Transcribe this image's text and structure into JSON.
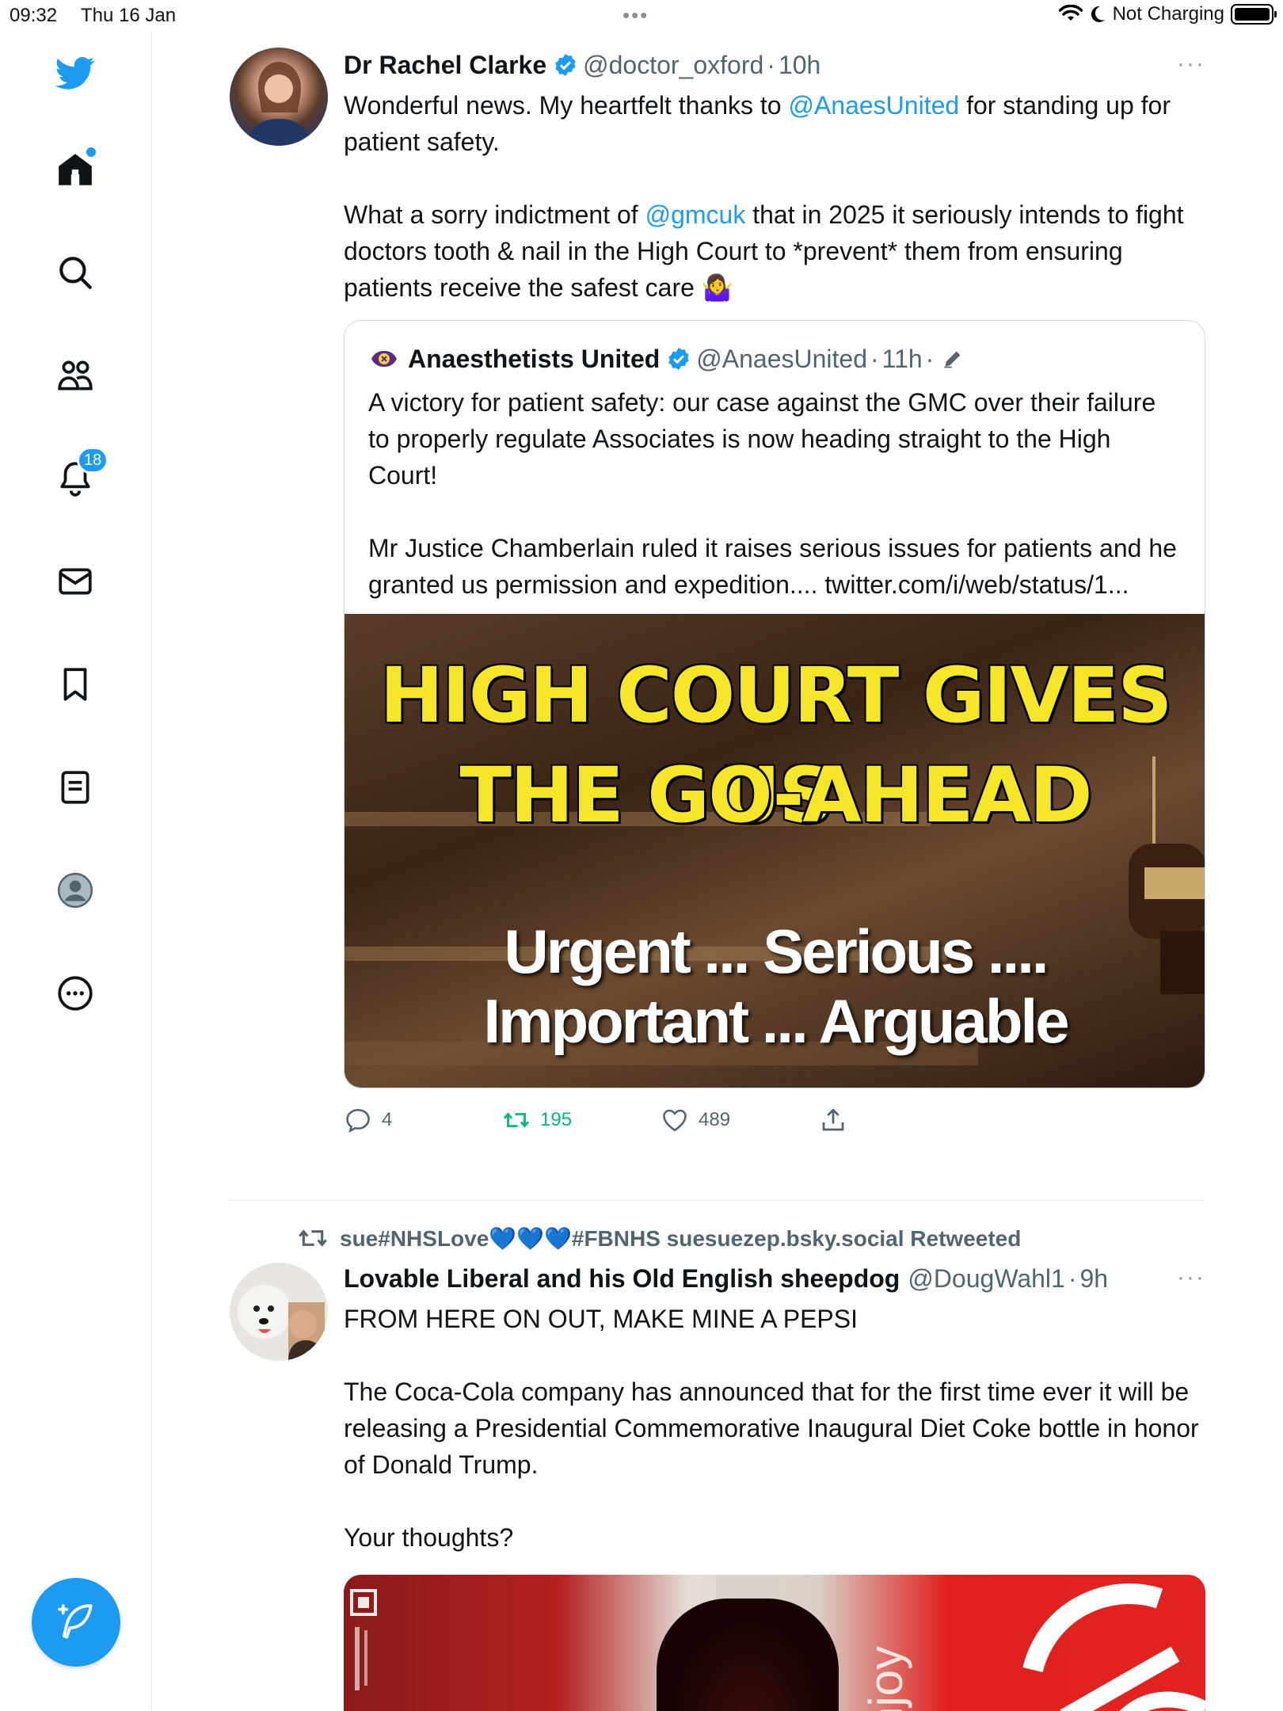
{
  "status_bar": {
    "time": "09:32",
    "date": "Thu 16 Jan",
    "battery_text": "Not Charging"
  },
  "sidebar": {
    "items": [
      {
        "icon": "twitter-logo-icon"
      },
      {
        "icon": "home-icon"
      },
      {
        "icon": "search-icon"
      },
      {
        "icon": "communities-icon"
      },
      {
        "icon": "notifications-icon",
        "badge": "18"
      },
      {
        "icon": "messages-icon"
      },
      {
        "icon": "bookmarks-icon"
      },
      {
        "icon": "lists-icon"
      },
      {
        "icon": "profile-icon"
      },
      {
        "icon": "more-icon"
      }
    ],
    "compose_icon": "compose-tweet-icon"
  },
  "colors": {
    "accent": "#1d9bf0",
    "retweet_green": "#00ba7c",
    "secondary_text": "#536471",
    "border": "#cfd9de",
    "image_title_yellow": "#f5e62a"
  },
  "tweet1": {
    "name": "Dr Rachel Clarke",
    "handle": "@doctor_oxford",
    "sep": "·",
    "time": "10h",
    "more": "···",
    "p1_a": "Wonderful news. My heartfelt thanks to ",
    "p1_mention": "@AnaesUnited",
    "p1_b": " for standing up for patient safety.",
    "p2_a": "What a sorry indictment of ",
    "p2_mention": "@gmcuk",
    "p2_b": " that in 2025 it seriously intends to fight doctors tooth & nail in the High Court to *prevent* them from ensuring patients receive the safest care 🤷‍♀️",
    "quote": {
      "name": "Anaesthetists United",
      "handle": "@AnaesUnited",
      "sep": "·",
      "time": "11h",
      "sep2": "·",
      "p1": "A victory for patient safety: our case against the GMC over their failure to properly regulate Associates is now heading straight to the High Court!",
      "p2": "Mr Justice Chamberlain ruled it raises serious issues for patients and he granted us permission and expedition.... twitter.com/i/web/status/1...",
      "image_line1": "HIGH COURT GIVES US",
      "image_line2": "THE GO-AHEAD",
      "image_line3": "Urgent ... Serious ....",
      "image_line4": "Important ... Arguable"
    },
    "replies": "4",
    "retweets": "195",
    "likes": "489"
  },
  "tweet2": {
    "retweeted_by": "sue#NHSLove💙💙💙#FBNHS suesuezep.bsky.social Retweeted",
    "name": "Lovable Liberal and his Old English sheepdog",
    "handle": "@DougWahl1",
    "sep": "·",
    "time": "9h",
    "more": "···",
    "p1": "FROM HERE ON OUT, MAKE MINE A PEPSI",
    "p2": "The Coca-Cola company has announced that for the first time ever it will be releasing a Presidential Commemorative Inaugural Diet Coke bottle in honor of Donald Trump.",
    "p3": "Your thoughts?",
    "image_text": "njoy"
  }
}
